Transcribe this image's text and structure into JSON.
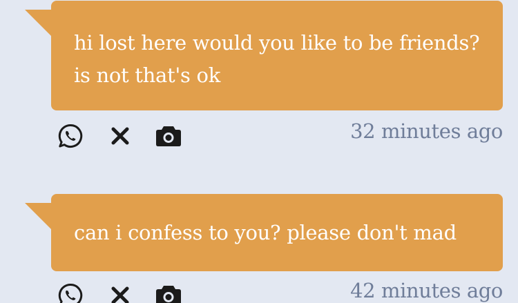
{
  "messages": [
    {
      "text": "hi lost here would you like to be friends?\nis not that's ok",
      "time": "32 minutes ago",
      "icons": [
        "whatsapp-icon",
        "close-icon",
        "camera-icon"
      ]
    },
    {
      "text": "can i confess to you? please don't mad",
      "time": "42 minutes ago",
      "icons": [
        "whatsapp-icon",
        "close-icon",
        "camera-icon"
      ]
    }
  ],
  "colors": {
    "bubble": "#e19f4c",
    "background": "#e3e8f2",
    "timestamp": "#6f7d99",
    "icon": "#1b1b1b"
  }
}
